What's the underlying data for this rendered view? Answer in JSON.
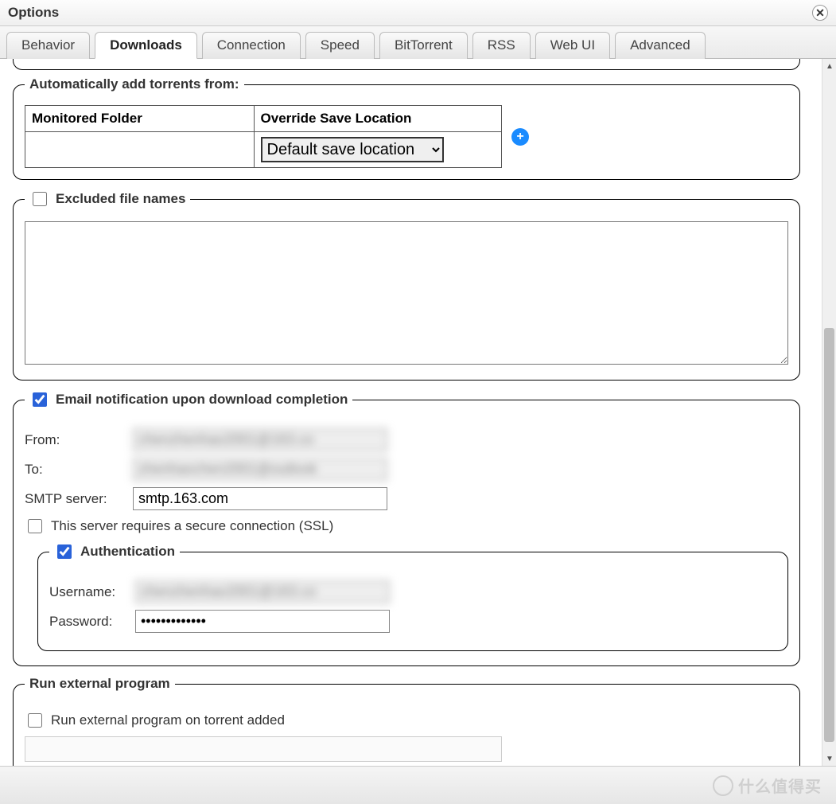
{
  "window": {
    "title": "Options"
  },
  "tabs": [
    {
      "label": "Behavior"
    },
    {
      "label": "Downloads",
      "active": true
    },
    {
      "label": "Connection"
    },
    {
      "label": "Speed"
    },
    {
      "label": "BitTorrent"
    },
    {
      "label": "RSS"
    },
    {
      "label": "Web UI"
    },
    {
      "label": "Advanced"
    }
  ],
  "auto_add": {
    "legend": "Automatically add torrents from:",
    "col_folder": "Monitored Folder",
    "col_override": "Override Save Location",
    "folder_value": "",
    "override_selected": "Default save location",
    "override_options": [
      "Default save location"
    ]
  },
  "excluded": {
    "legend": "Excluded file names",
    "checked": false,
    "value": ""
  },
  "email": {
    "legend": "Email notification upon download completion",
    "checked": true,
    "from_label": "From:",
    "from_value": "chenzhenhao2001@163.co",
    "to_label": "To:",
    "to_value": "zhenhaochen2001@outlook",
    "smtp_label": "SMTP server:",
    "smtp_value": "smtp.163.com",
    "ssl_label": "This server requires a secure connection (SSL)",
    "ssl_checked": false,
    "auth": {
      "legend": "Authentication",
      "checked": true,
      "user_label": "Username:",
      "user_value": "chenzhenhao2001@163.co",
      "pass_label": "Password:",
      "pass_value": "•••••••••••••"
    }
  },
  "external": {
    "legend": "Run external program",
    "on_add_label": "Run external program on torrent added",
    "on_add_checked": false,
    "on_add_value": ""
  },
  "watermark": "什么值得买"
}
